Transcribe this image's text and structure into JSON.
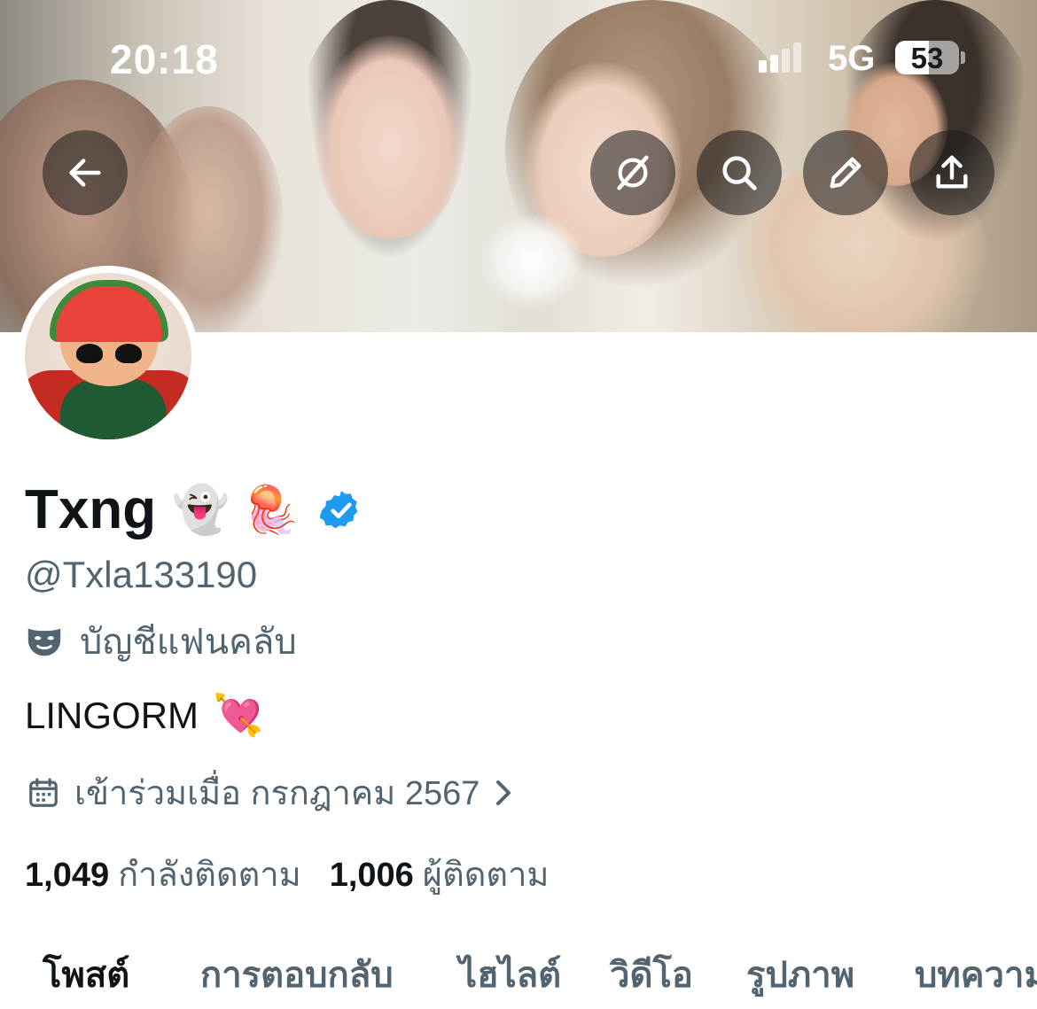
{
  "status_bar": {
    "time": "20:18",
    "network": "5G",
    "battery": "53",
    "battery_level": 0.53
  },
  "header": {
    "buttons": [
      {
        "icon": "arrow-left-icon"
      },
      {
        "icon": "grok-icon"
      },
      {
        "icon": "search-icon"
      },
      {
        "icon": "pencil-icon"
      },
      {
        "icon": "share-icon"
      }
    ]
  },
  "profile": {
    "display_name": "Txng",
    "name_emojis": "👻 🪼",
    "handle": "@Txla133190",
    "label": "บัญชีแฟนคลับ",
    "bio": "LINGORM",
    "bio_emoji": "💘",
    "joined": "เข้าร่วมเมื่อ กรกฎาคม 2567",
    "following_count": "1,049",
    "following_label": "กำลังติดตาม",
    "followers_count": "1,006",
    "followers_label": "ผู้ติดตาม"
  },
  "tabs": [
    {
      "label": "โพสต์",
      "active": true
    },
    {
      "label": "การตอบกลับ",
      "active": false
    },
    {
      "label": "ไฮไลต์",
      "active": false
    },
    {
      "label": "วิดีโอ",
      "active": false
    },
    {
      "label": "รูปภาพ",
      "active": false
    },
    {
      "label": "บทความ",
      "active": false
    }
  ],
  "colors": {
    "text_primary": "#0f1419",
    "text_secondary": "#536471",
    "verified_blue": "#1d9bf0"
  }
}
